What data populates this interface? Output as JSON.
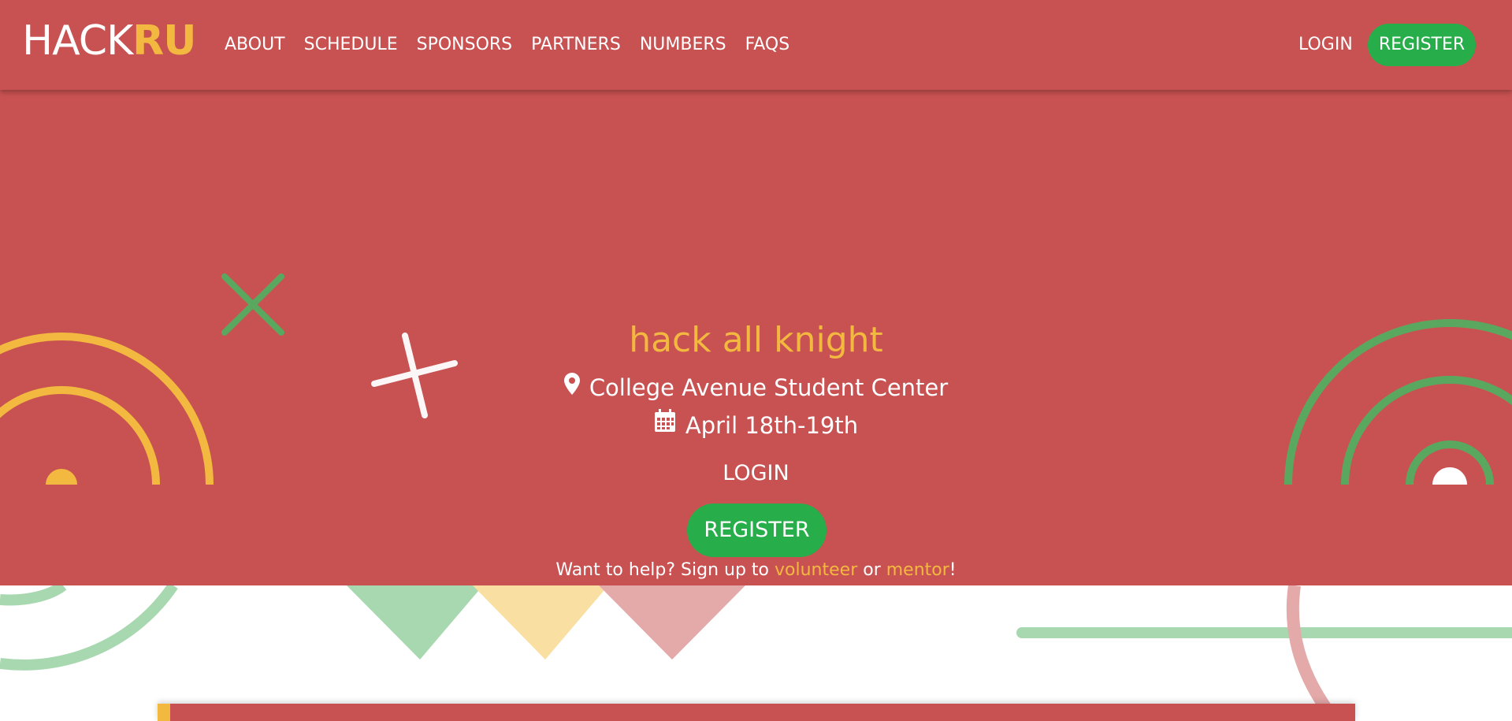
{
  "brand": {
    "part_a": "HACK",
    "part_b": "RU"
  },
  "nav": {
    "links": [
      "ABOUT",
      "SCHEDULE",
      "SPONSORS",
      "PARTNERS",
      "NUMBERS",
      "FAQS"
    ],
    "login_label": "LOGIN",
    "register_label": "REGISTER"
  },
  "hero": {
    "tagline": "hack all knight",
    "location": "College Avenue Student Center",
    "location_icon": "map-marker-icon",
    "date": "April 18th-19th",
    "date_icon": "calendar-icon",
    "login_label": "LOGIN",
    "register_label": "REGISTER",
    "help": {
      "prefix": "Want to help? Sign up to ",
      "volunteer_link": "volunteer",
      "middle": " or ",
      "mentor_link": "mentor",
      "suffix": "!"
    }
  },
  "colors": {
    "primary_red": "#c85252",
    "accent_yellow": "#f3b83f",
    "accent_green": "#27ad4a",
    "deco_green": "#5aa85f",
    "white": "#ffffff"
  }
}
